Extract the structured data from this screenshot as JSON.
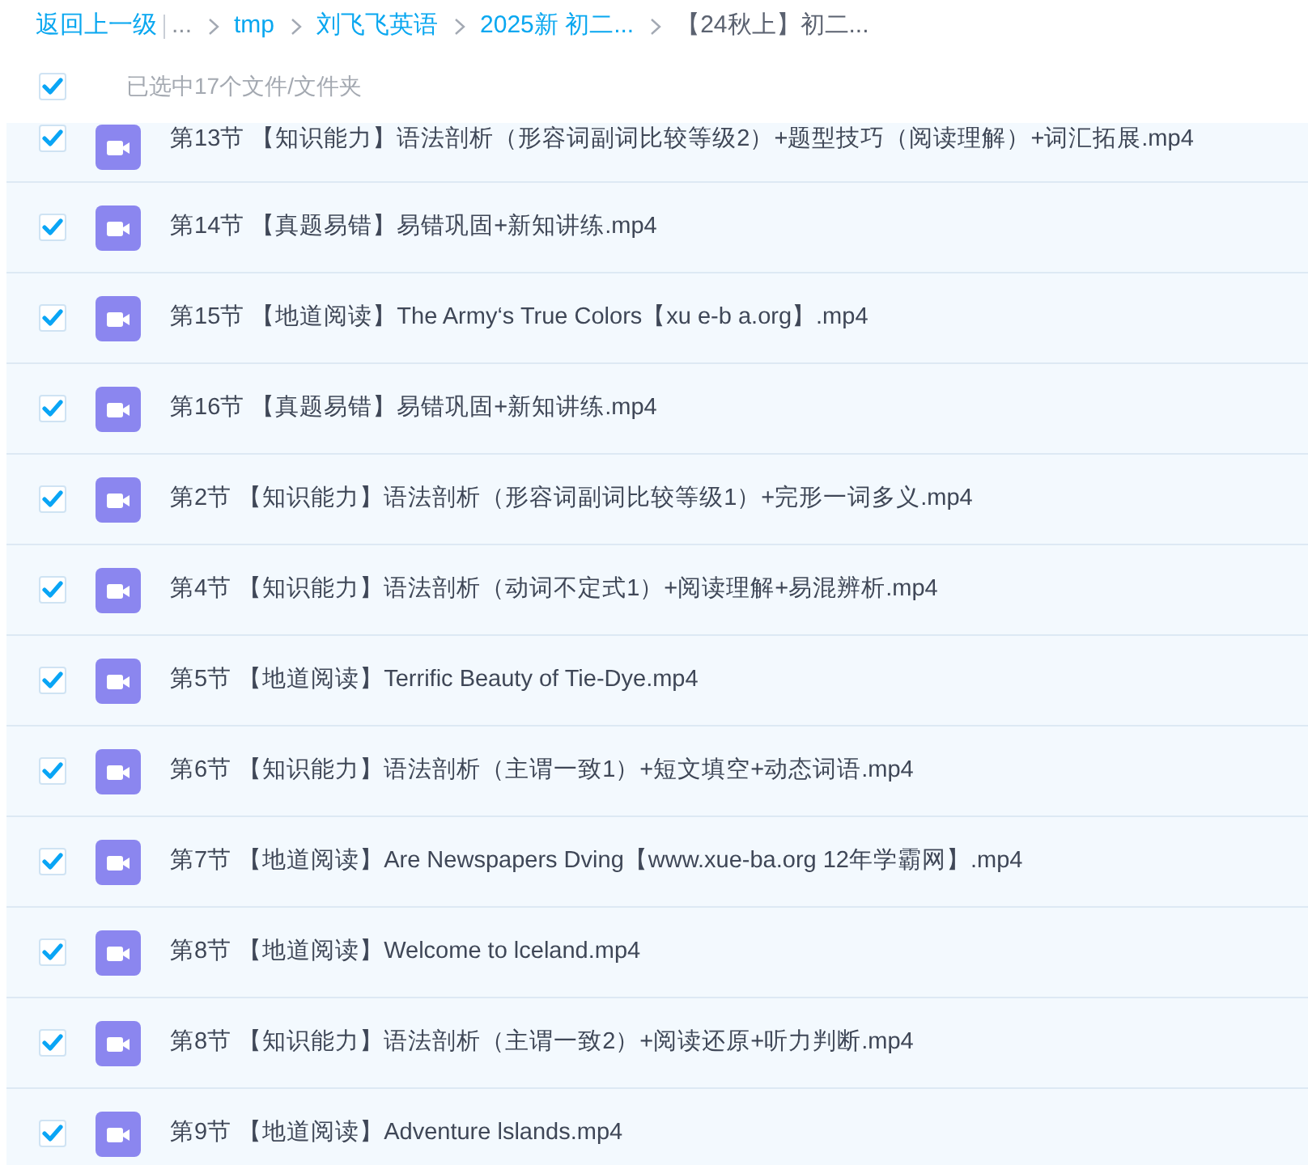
{
  "breadcrumb": {
    "back": "返回上一级",
    "items": [
      {
        "label": "...",
        "kind": "ellipsis"
      },
      {
        "label": "tmp",
        "kind": "link"
      },
      {
        "label": "刘飞飞英语",
        "kind": "link"
      },
      {
        "label": "2025新 初二...",
        "kind": "link"
      },
      {
        "label": "【24秋上】初二...",
        "kind": "current"
      }
    ]
  },
  "selection": {
    "checked": true,
    "label": "已选中17个文件/文件夹"
  },
  "files": [
    {
      "name": "第13节 【知识能力】语法剖析（形容词副词比较等级2）+题型技巧（阅读理解）+词汇拓展.mp4",
      "checked": true
    },
    {
      "name": "第14节 【真题易错】易错巩固+新知讲练.mp4",
      "checked": true
    },
    {
      "name": "第15节 【地道阅读】The Army‘s True Colors【xu e-b a.org】.mp4",
      "checked": true
    },
    {
      "name": "第16节 【真题易错】易错巩固+新知讲练.mp4",
      "checked": true
    },
    {
      "name": "第2节 【知识能力】语法剖析（形容词副词比较等级1）+完形一词多义.mp4",
      "checked": true
    },
    {
      "name": "第4节 【知识能力】语法剖析（动词不定式1）+阅读理解+易混辨析.mp4",
      "checked": true
    },
    {
      "name": "第5节 【地道阅读】Terrific Beauty of Tie-Dye.mp4",
      "checked": true
    },
    {
      "name": "第6节 【知识能力】语法剖析（主谓一致1）+短文填空+动态词语.mp4",
      "checked": true
    },
    {
      "name": "第7节 【地道阅读】Are Newspapers Dving【www.xue-ba.org 12年学霸网】.mp4",
      "checked": true
    },
    {
      "name": "第8节 【地道阅读】Welcome to lceland.mp4",
      "checked": true
    },
    {
      "name": "第8节 【知识能力】语法剖析（主谓一致2）+阅读还原+听力判断.mp4",
      "checked": true
    },
    {
      "name": "第9节 【地道阅读】Adventure lslands.mp4",
      "checked": true
    }
  ]
}
